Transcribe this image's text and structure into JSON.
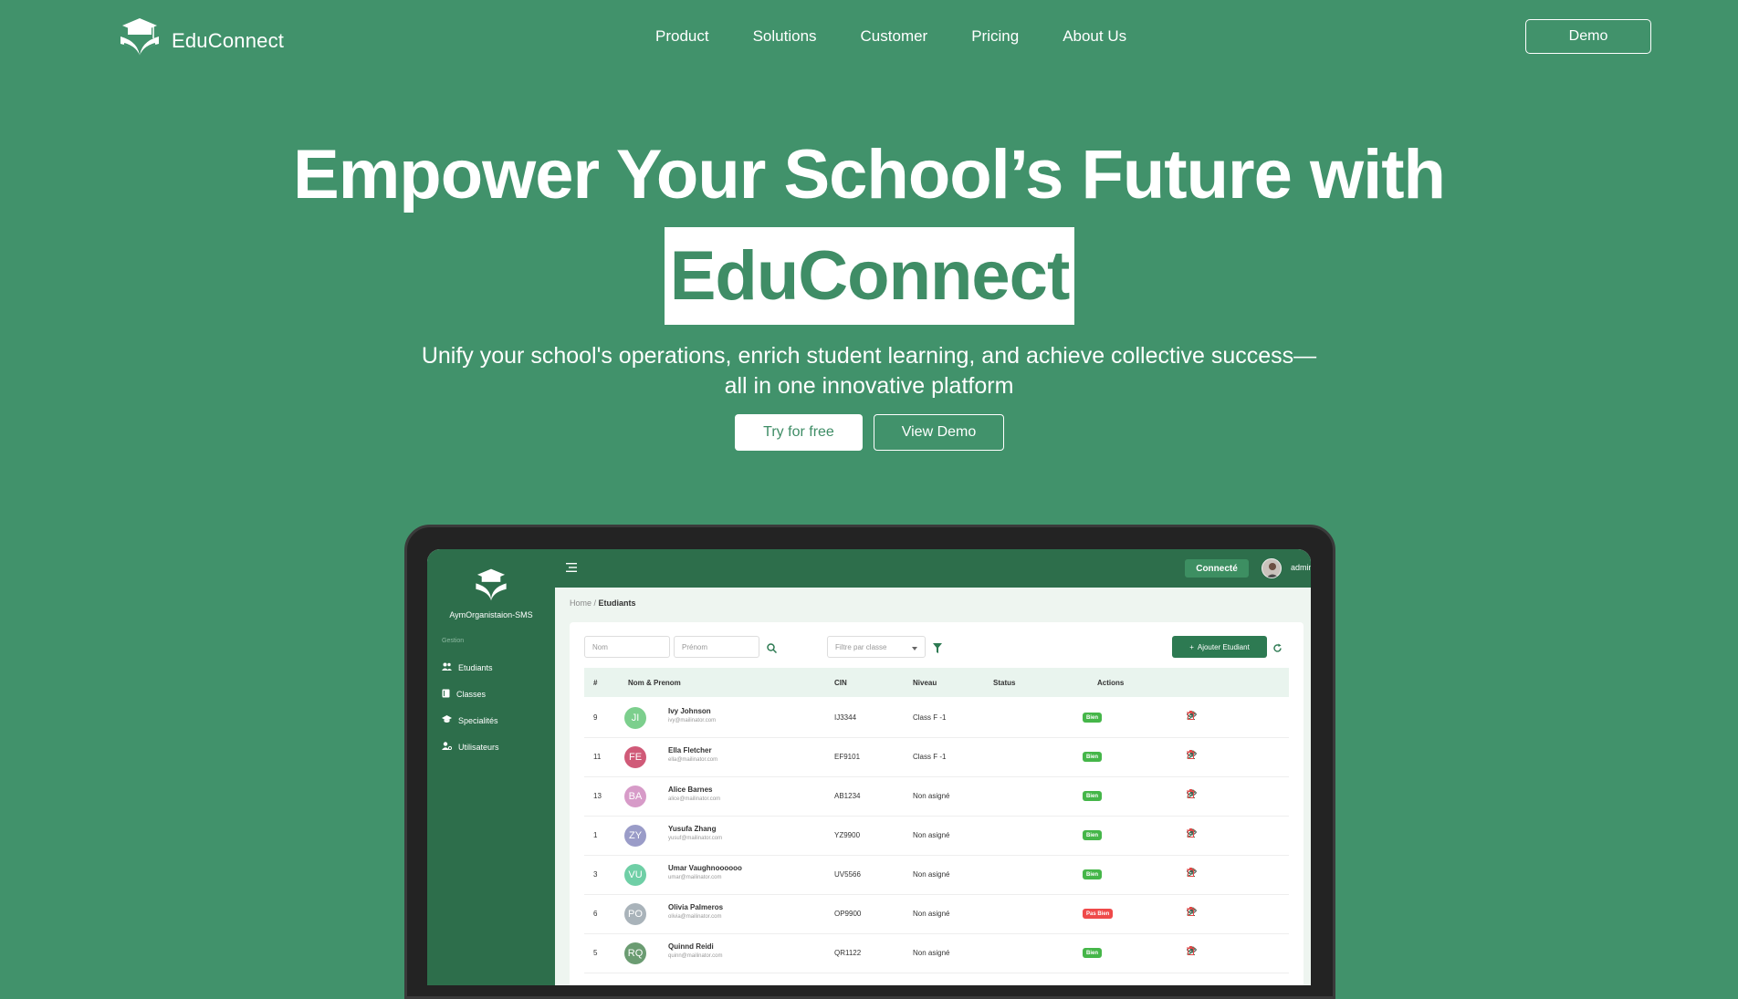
{
  "header": {
    "brand": "EduConnect",
    "nav": [
      "Product",
      "Solutions",
      "Customer",
      "Pricing",
      "About Us"
    ],
    "demo_label": "Demo"
  },
  "hero": {
    "title": "Empower Your School’s Future with",
    "highlight": "EduConnect",
    "subtitle": "Unify your school's operations, enrich student learning, and achieve collective success—all in one innovative platform",
    "try_label": "Try for free",
    "view_label": "View Demo"
  },
  "app": {
    "org_name": "AymOrganistaion-SMS",
    "sidebar_section": "Gestion",
    "sidebar_items": [
      "Etudiants",
      "Classes",
      "Specialités",
      "Utilisateurs"
    ],
    "status_label": "Connecté",
    "user_name": "admin",
    "breadcrumb_home": "Home",
    "breadcrumb_current": "Etudiants",
    "filters": {
      "nom_placeholder": "Nom",
      "prenom_placeholder": "Prénom",
      "class_filter": "Filtre par classe"
    },
    "add_label": "Ajouter Etudiant",
    "columns": [
      "#",
      "Nom & Prenom",
      "CIN",
      "Niveau",
      "Status",
      "Actions"
    ],
    "rows": [
      {
        "id": "9",
        "initials": "JI",
        "name": "Ivy Johnson",
        "email": "ivy@mailinator.com",
        "cin": "IJ3344",
        "niveau": "Class F -1",
        "status": "Bien",
        "color": "#7ccf8d"
      },
      {
        "id": "11",
        "initials": "FE",
        "name": "Ella Fletcher",
        "email": "ella@mailinator.com",
        "cin": "EF9101",
        "niveau": "Class F -1",
        "status": "Bien",
        "color": "#d05a78"
      },
      {
        "id": "13",
        "initials": "BA",
        "name": "Alice Barnes",
        "email": "alice@mailinator.com",
        "cin": "AB1234",
        "niveau": "Non asigné",
        "status": "Bien",
        "color": "#d79bc8"
      },
      {
        "id": "1",
        "initials": "ZY",
        "name": "Yusufa Zhang",
        "email": "yusuf@mailinator.com",
        "cin": "YZ9900",
        "niveau": "Non asigné",
        "status": "Bien",
        "color": "#9a9cc8"
      },
      {
        "id": "3",
        "initials": "VU",
        "name": "Umar Vaughnoooooo",
        "email": "umar@mailinator.com",
        "cin": "UV5566",
        "niveau": "Non asigné",
        "status": "Bien",
        "color": "#6fcfa6"
      },
      {
        "id": "6",
        "initials": "PO",
        "name": "Olivia Palmeros",
        "email": "olivia@mailinator.com",
        "cin": "OP9900",
        "niveau": "Non asigné",
        "status": "Pas Bien",
        "color": "#a9b3ba"
      },
      {
        "id": "5",
        "initials": "RQ",
        "name": "Quinnd Reidi",
        "email": "quinn@mailinator.com",
        "cin": "QR1122",
        "niveau": "Non asigné",
        "status": "Bien",
        "color": "#6b9c72"
      }
    ],
    "status_colors": {
      "Bien": "#45b649",
      "Pas Bien": "#ef4a4a"
    }
  }
}
